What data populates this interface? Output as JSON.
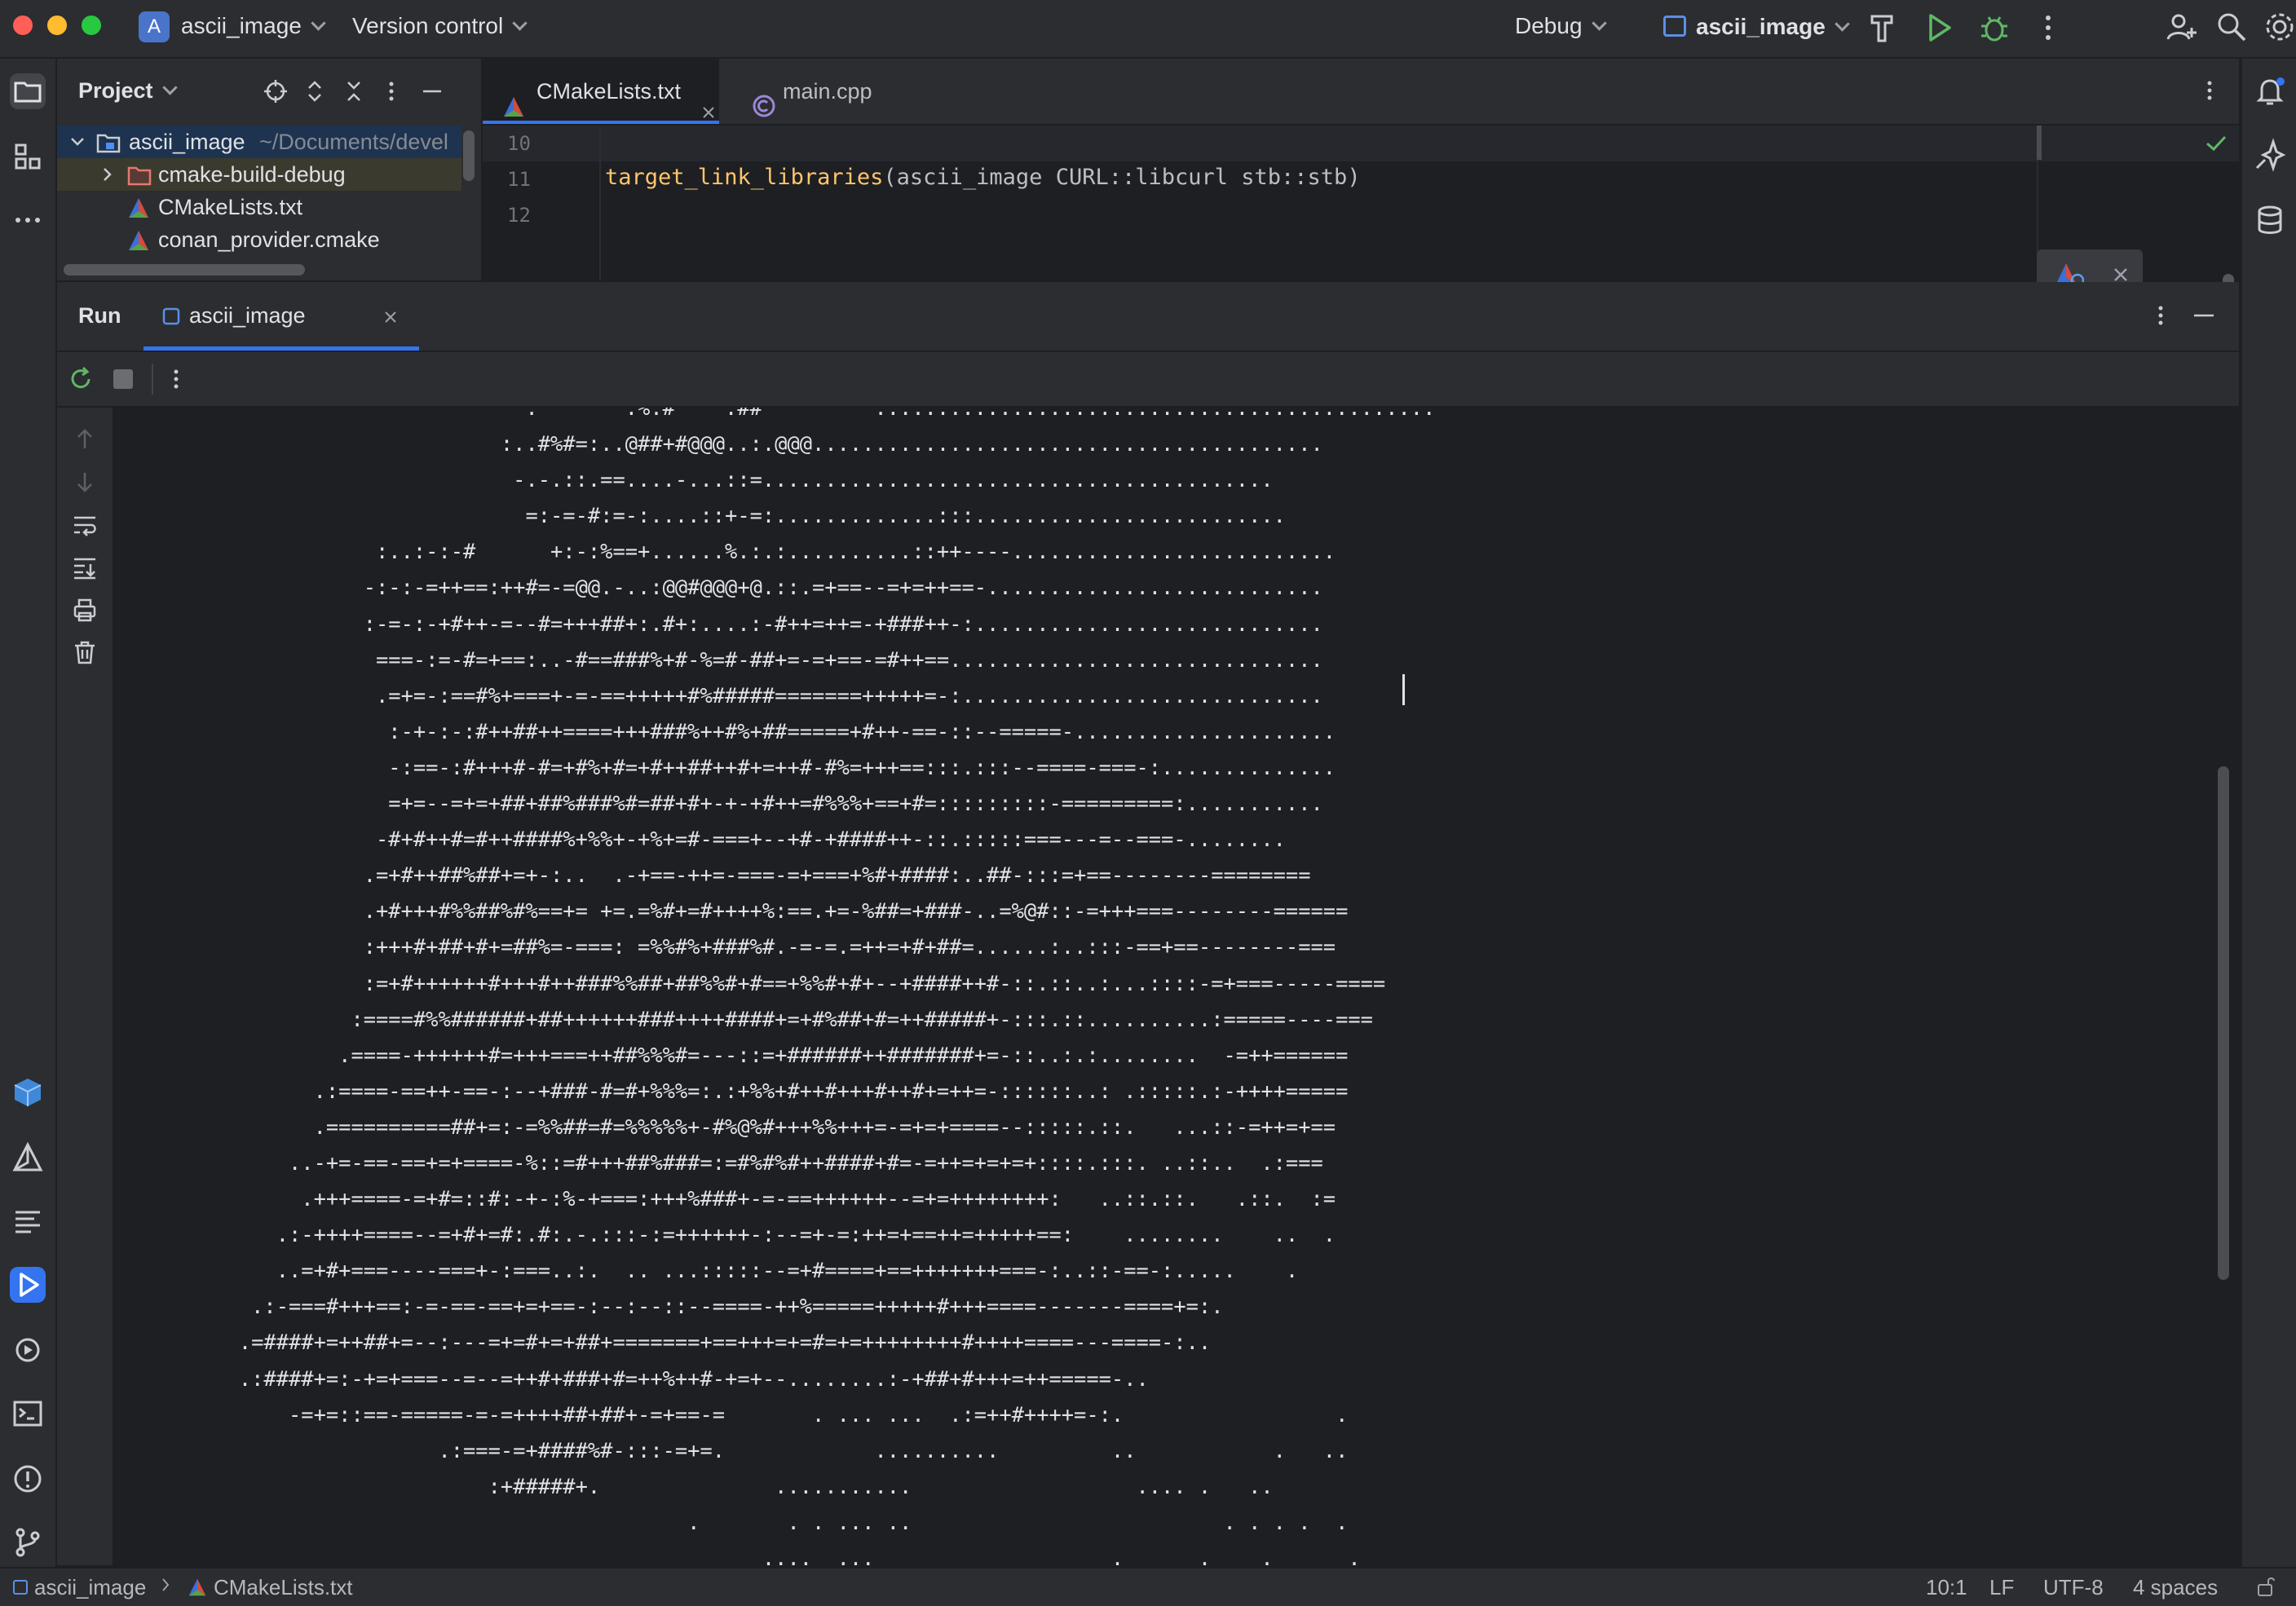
{
  "titlebar": {
    "project_badge": "A",
    "project_name": "ascii_image",
    "vcs_label": "Version control",
    "config_label": "Debug",
    "run_target": "ascii_image",
    "icons": [
      "hammer-icon",
      "run-icon",
      "debug-icon",
      "more-vertical-icon",
      "add-user-icon",
      "search-icon",
      "settings-icon"
    ]
  },
  "project_panel": {
    "title": "Project",
    "tree": [
      {
        "name": "ascii_image",
        "hint": "~/Documents/devel",
        "kind": "folder-root",
        "expanded": true
      },
      {
        "name": "cmake-build-debug",
        "kind": "folder",
        "expanded": false
      },
      {
        "name": "CMakeLists.txt",
        "kind": "cmake-file"
      },
      {
        "name": "conan_provider.cmake",
        "kind": "cmake-file"
      }
    ]
  },
  "editor": {
    "tabs": [
      {
        "label": "CMakeLists.txt",
        "active": true,
        "closable": true
      },
      {
        "label": "main.cpp",
        "active": false
      }
    ],
    "lines": [
      {
        "number": "10",
        "text": ""
      },
      {
        "number": "11",
        "fn": "target_link_libraries",
        "args": "(ascii_image CURL::libcurl stb::stb)"
      },
      {
        "number": "12",
        "text": ""
      }
    ]
  },
  "run_panel": {
    "title": "Run",
    "tab_label": "ascii_image",
    "output": [
      "                         .       .%.#    .##         .............................................",
      "                       :..#%#=:..@##+#@@@..:.@@@.........................................",
      "                        -.-.::.==....-...::=.........................................",
      "                         =:-=-#:=-:....::+-=:.............:::.........................",
      "             :..:-:-#      +:-:%==+......%.:.:..........::++----..........................",
      "            -:-:-=++==:++#=-=@@.-..:@@#@@@+@.::.=+==--=+=++==-...........................",
      "            :-=-:-+#++-=--#=+++##+:.#+:....:-#++=++=-+###++-:............................",
      "             ===-:=-#=+==:..-#==###%+#-%=#-##+=-=+==-=#++==..............................",
      "             .=+=-:==#%+===+-=-==+++++#%#####=======+++++=-:.............................",
      "              :-+-:-:#++##++====+++###%++#%+##=====+#++-==-::--=====-.....................",
      "              -:==-:#+++#-#=+#%+#=+#++##++#+=++#-#%=+++==:::.:::--====-===-:..............",
      "              =+=--=+=+##+##%###%#=##+#+-+-+#++=#%%%+==+#=:::::::::-=========:...........",
      "             -#+#++#=#++####%+%%+-+%+=#-===+--+#-+####++-::.:::::===---=--===-........",
      "            .=+#++##%##+=+-:..  .-+==-++=-===-=+===+%#+####:..##-:::=+==--------========",
      "            .+#+++#%%##%#%==+= +=.=%#+=#++++%:==.+=-%##=+###-..=%@#::-=+++===--------======",
      "            :+++#+##+#+=##%=-===: =%%#%+###%#.-=-=.=++=+#+##=......:..:::-==+==--------===",
      "            :=+#++++++#+++#++###%%##+##%%#+#==+%%#+#+--+####++#-::.::..:...::::-=+===-----====",
      "           :====#%%######+##++++++###++++####+=+#%##+#=++#####+-:::.::..........:=====----===",
      "          .====-++++++#=+++===++##%%%#=---::=+######++#######+=-::..:.:........  -=++======",
      "        .:====-==++-==-:--+###-#=#+%%%=:.:+%%+#++#+++#++#+=++=-::::::..: .:::::.:-++++=====",
      "        .==========##+=:-=%%##=#=%%%%%+-#%@%#+++%%+++=-=+=+====--:::::.::.   ...::-=++=+==",
      "      ..-+=-==-==+=+====-%::=#+++##%###=:=#%#%#++####+#=-=++=+=+=+::::.:::. ..::..  .:===",
      "       .+++====-=+#=::#:-+-:%-+===:+++%###+-=-==++++++--=+=++++++++:   ..::.::.   .::.  :=",
      "     .:-++++====--=+#+=#:.#:.-.:::-:=++++++-:--=+-=:++=+==++=+++++==:    ........    ..  .",
      "     ..=+#+===----===+-:===..:.  .. ...:::::--=+#====+==+++++++===-:..::-==-:.....    .",
      "   .:-===#+++==:-=-==-==+=+==-:--:--::--====-++%=====+++++#+++====-------====+=:.",
      "  .=####+=++##+=--:---=+=#+=+##+=======+==+++=+=#=+=++++++++#++++====---====-:..",
      "  .:####+=:-+=+===--=--=++#+###+#=++%++#-+=+--........:-+##+#+++=++=====-..",
      "      -=+=::==-=====-=-=++++##+##+-=+==-=       . ... ...  .:=++#++++=-:.                 .",
      "                  .:===-=+####%#-:::-=+=.            ..........         ..           .   ..",
      "                      :+#####+.              ...........                  .... .   ..",
      "                                      .       . . ... ..                         . . . .  .",
      "                                            ....  ...                   .      .    .      ."
    ]
  },
  "statusbar": {
    "breadcrumb_project": "ascii_image",
    "breadcrumb_file": "CMakeLists.txt",
    "position": "10:1",
    "line_ending": "LF",
    "encoding": "UTF-8",
    "indent": "4 spaces"
  }
}
